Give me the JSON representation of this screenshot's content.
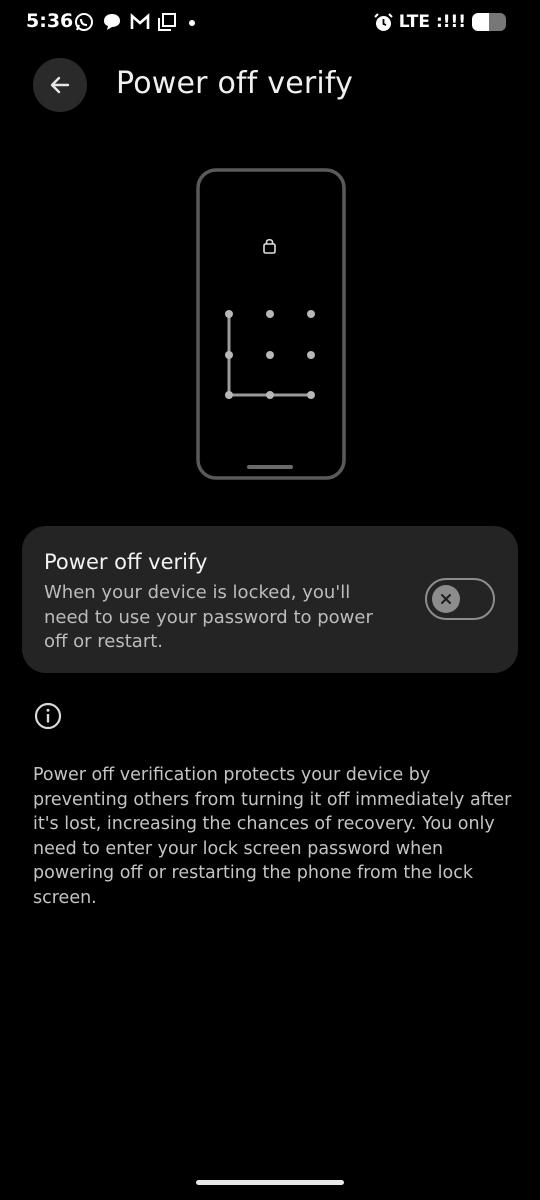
{
  "status_bar": {
    "time": "5:36",
    "network": "LTE",
    "signal_text": ":!!!",
    "battery_level": 0.5,
    "left_icons": [
      "whatsapp-icon",
      "chat-bubble-icon",
      "gmail-icon",
      "screen-icon",
      "dot-icon"
    ],
    "right_icons": [
      "alarm-icon",
      "signal-icon",
      "battery-icon"
    ]
  },
  "header": {
    "title": "Power off verify",
    "back_icon": "arrow-left-icon"
  },
  "setting_card": {
    "title": "Power off verify",
    "description": "When your device is locked, you'll need to use your password to power off or restart.",
    "toggle_state": "off",
    "toggle_icon": "close-icon"
  },
  "info": {
    "icon": "info-icon",
    "text": "Power off verification protects your device by preventing others from turning it off immediately after it's lost, increasing the chances of recovery. You only need to enter your lock screen password when powering off or restarting the phone from the lock screen."
  },
  "colors": {
    "background": "#000000",
    "card": "#242424",
    "text_primary": "#f2f2f2",
    "text_secondary": "#bcbcbc"
  }
}
